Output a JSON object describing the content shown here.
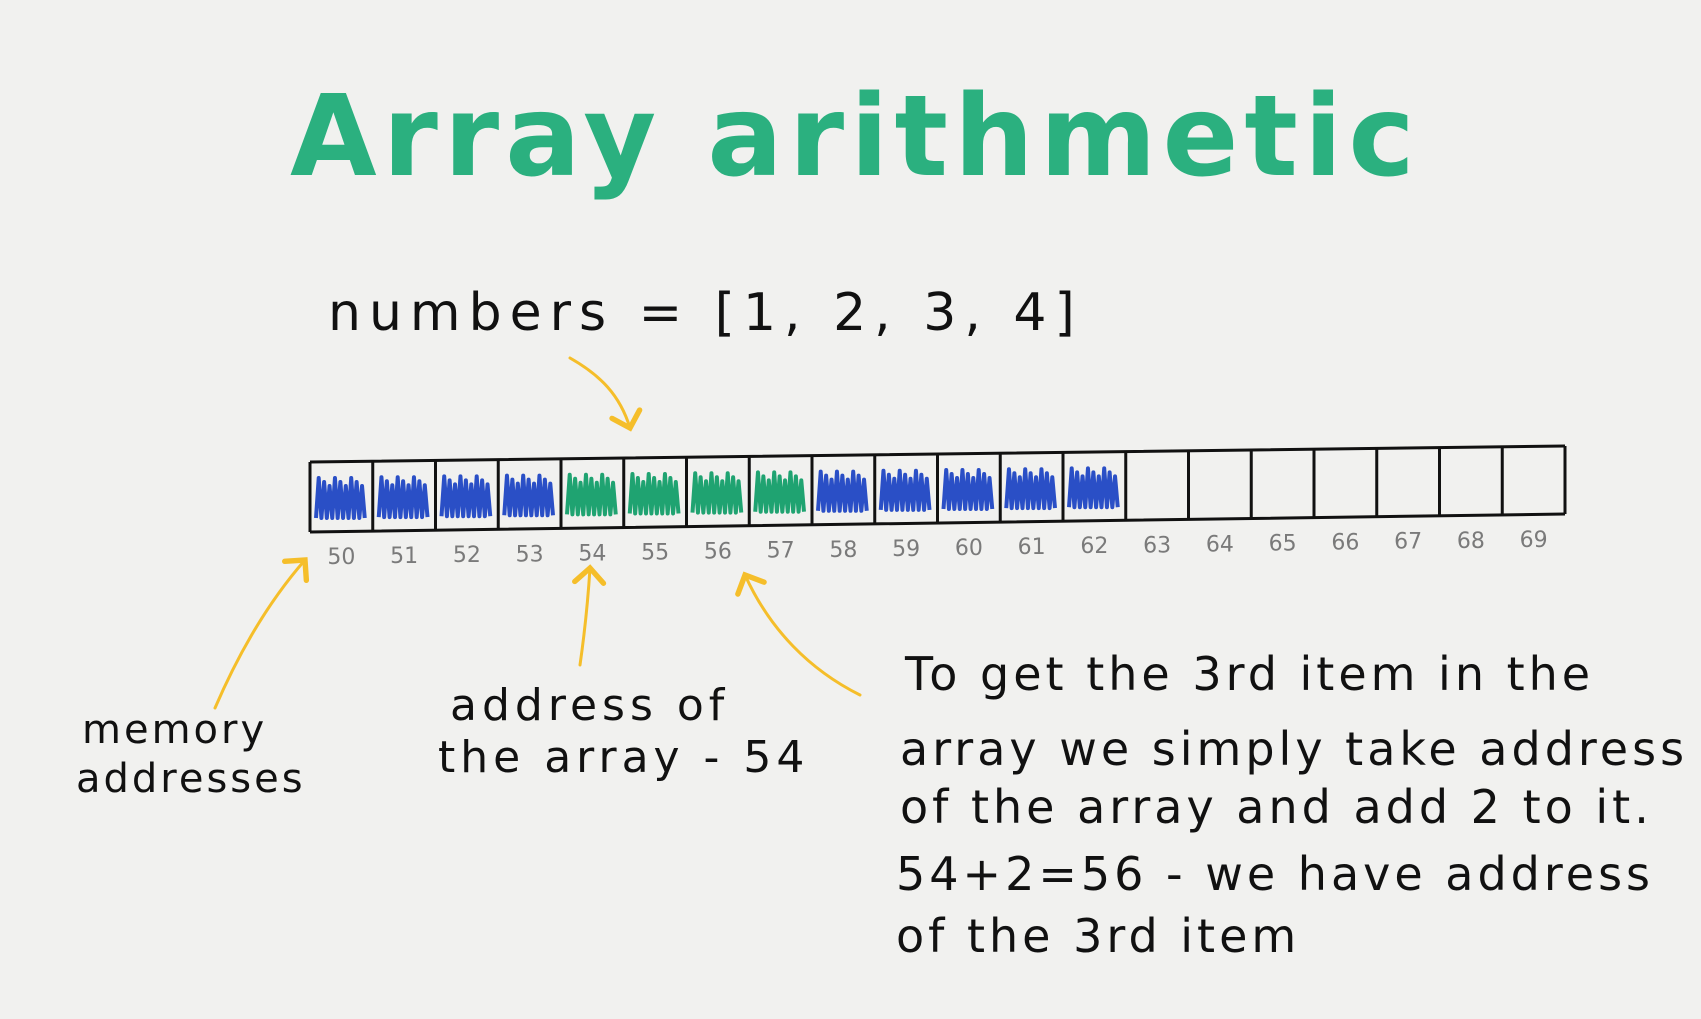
{
  "title": "Array arithmetic",
  "code_line": "numbers = [1, 2, 3, 4]",
  "memory": {
    "addresses": [
      "50",
      "51",
      "52",
      "53",
      "54",
      "55",
      "56",
      "57",
      "58",
      "59",
      "60",
      "61",
      "62",
      "63",
      "64",
      "65",
      "66",
      "67",
      "68",
      "69"
    ],
    "cell_fill": [
      "blue",
      "blue",
      "blue",
      "blue",
      "green",
      "green",
      "green",
      "green",
      "blue",
      "blue",
      "blue",
      "blue",
      "blue",
      "empty",
      "empty",
      "empty",
      "empty",
      "empty",
      "empty",
      "empty"
    ]
  },
  "labels": {
    "memory_addresses": [
      "memory",
      "addresses"
    ],
    "array_address": [
      "address of",
      "the array - 54"
    ],
    "explanation": [
      "To get the 3rd item in the",
      "array we simply take address",
      "of the array and add 2 to it.",
      "54+2=56 - we have address",
      "of the 3rd item"
    ]
  },
  "colors": {
    "title": "#2bb07f",
    "ink": "#111111",
    "blue": "#2a4fc6",
    "green": "#1fa371",
    "arrow": "#f5be2a",
    "address_text": "#7a7a7a",
    "background": "#f1f1ef"
  }
}
